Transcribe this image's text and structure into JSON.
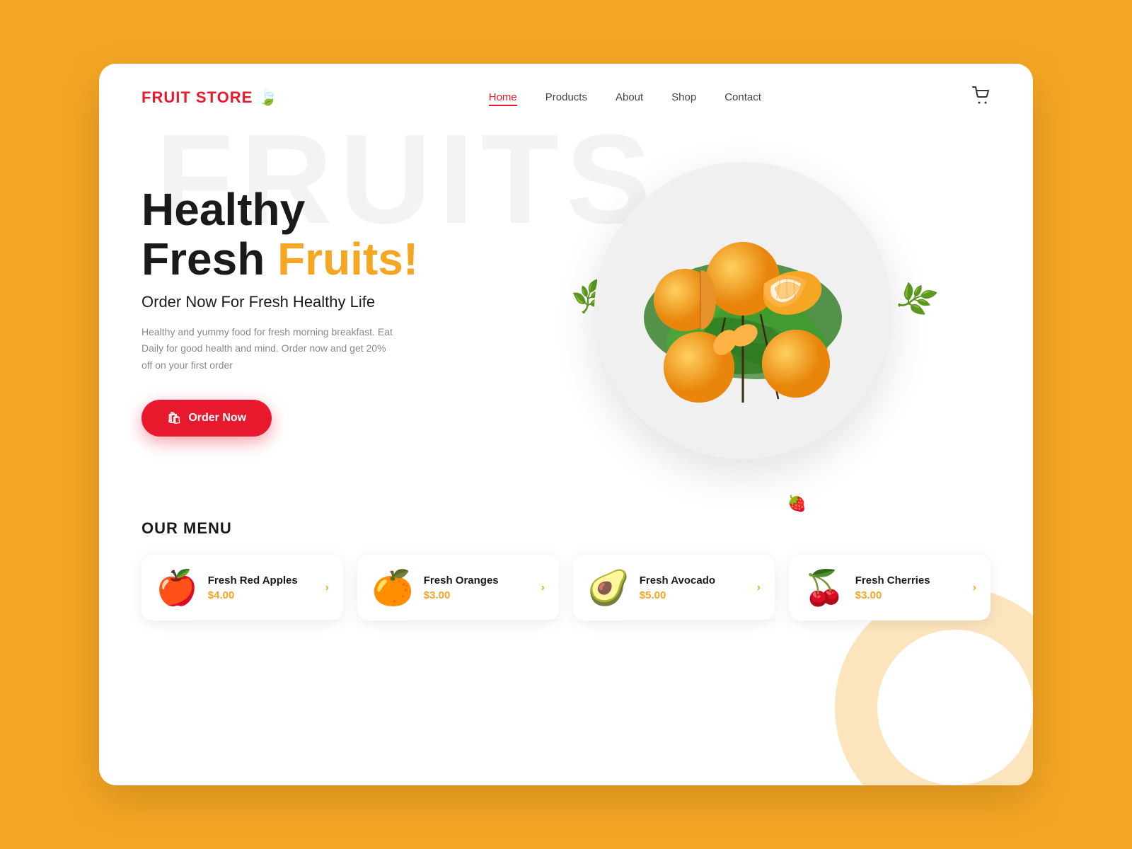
{
  "brand": {
    "name": "FRUIT STORE",
    "icon": "🍃"
  },
  "nav": {
    "links": [
      {
        "label": "Home",
        "active": true
      },
      {
        "label": "Products",
        "active": false
      },
      {
        "label": "About",
        "active": false
      },
      {
        "label": "Shop",
        "active": false
      },
      {
        "label": "Contact",
        "active": false
      }
    ],
    "cart_icon": "🛒"
  },
  "watermark": {
    "text": "FRUITS"
  },
  "hero": {
    "title_line1": "Healthy",
    "title_line2_normal": "Fresh ",
    "title_line2_highlight": "Fruits!",
    "subtitle": "Order Now For Fresh Healthy Life",
    "description": "Healthy and yummy food for fresh morning breakfast. Eat Daily for good health and mind. Order now and get 20% off on your first order",
    "cta_label": "Order Now",
    "cta_icon": "🛍"
  },
  "menu": {
    "title": "OUR MENU",
    "items": [
      {
        "name": "Fresh Red Apples",
        "price": "$4.00",
        "emoji": "🍎"
      },
      {
        "name": "Fresh Oranges",
        "price": "$3.00",
        "emoji": "🍊"
      },
      {
        "name": "Fresh Avocado",
        "price": "$5.00",
        "emoji": "🥑"
      },
      {
        "name": "Fresh Cherries",
        "price": "$3.00",
        "emoji": "🍒"
      }
    ]
  },
  "colors": {
    "primary_red": "#E8192C",
    "primary_orange": "#F5A623",
    "background": "#F5A623",
    "text_dark": "#1a1a1a",
    "text_muted": "#888888"
  }
}
